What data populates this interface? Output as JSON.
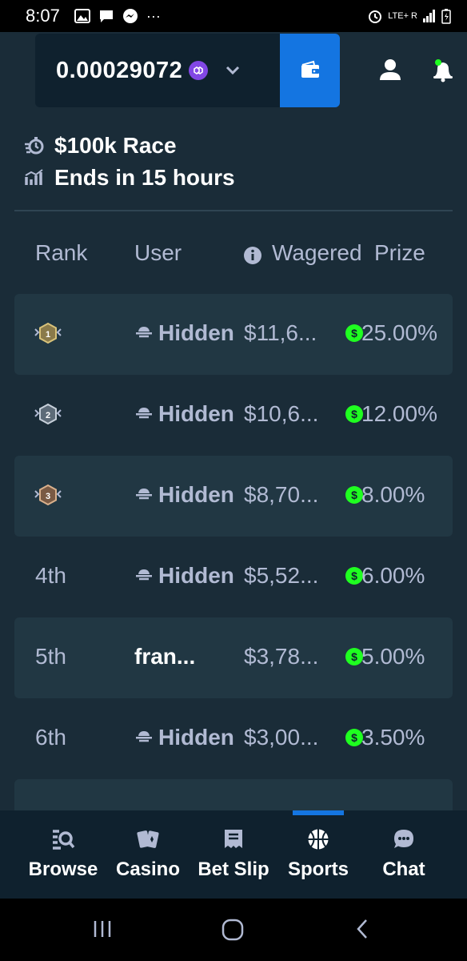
{
  "statusbar": {
    "time": "8:07",
    "more": "···",
    "network": "LTE+ R"
  },
  "header": {
    "balance": "0.00029072",
    "coin_icon": "polygon-coin-icon",
    "icons": [
      "chevron-down-icon",
      "wallet-icon",
      "user-icon",
      "notification-bell-icon"
    ]
  },
  "race": {
    "title": "$100k Race",
    "ends": "Ends in 15 hours"
  },
  "table": {
    "headers": {
      "rank": "Rank",
      "user": "User",
      "wagered": "Wagered",
      "prize": "Prize"
    },
    "rows": [
      {
        "rank": "1",
        "user": "Hidden",
        "wagered": "$11,6...",
        "prize": "25.00%"
      },
      {
        "rank": "2",
        "user": "Hidden",
        "wagered": "$10,6...",
        "prize": "12.00%"
      },
      {
        "rank": "3",
        "user": "Hidden",
        "wagered": "$8,70...",
        "prize": "8.00%"
      },
      {
        "rank": "4th",
        "user": "Hidden",
        "wagered": "$5,52...",
        "prize": "6.00%"
      },
      {
        "rank": "5th",
        "user": "fran...",
        "wagered": "$3,78...",
        "prize": "5.00%"
      },
      {
        "rank": "6th",
        "user": "Hidden",
        "wagered": "$3,00...",
        "prize": "3.50%"
      }
    ]
  },
  "nav": {
    "browse": "Browse",
    "casino": "Casino",
    "betslip": "Bet Slip",
    "sports": "Sports",
    "chat": "Chat",
    "active": "sports"
  },
  "colors": {
    "background": "#1a2c38",
    "panel": "#0f212e",
    "row": "#213743",
    "accent": "#1475e1",
    "money": "#1fff20"
  }
}
